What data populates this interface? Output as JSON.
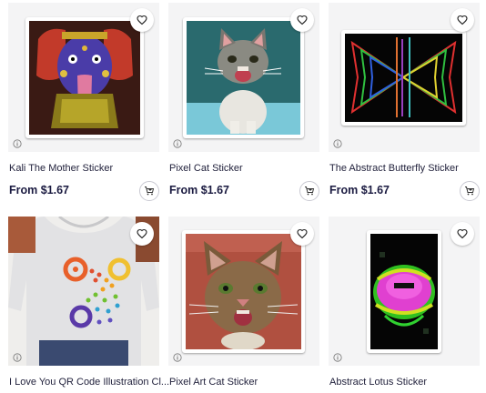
{
  "products": [
    {
      "title": "Kali The Mother Sticker",
      "price": "From $1.67"
    },
    {
      "title": "Pixel Cat Sticker",
      "price": "From $1.67"
    },
    {
      "title": "The Abstract Butterfly Sticker",
      "price": "From $1.67"
    },
    {
      "title": "I Love You QR Code Illustration Cl...",
      "price": ""
    },
    {
      "title": "Pixel Art Cat Sticker",
      "price": ""
    },
    {
      "title": "Abstract Lotus Sticker",
      "price": ""
    }
  ],
  "icons": {
    "favorite": "heart-icon",
    "info": "info-icon",
    "cart": "add-to-cart-icon"
  }
}
